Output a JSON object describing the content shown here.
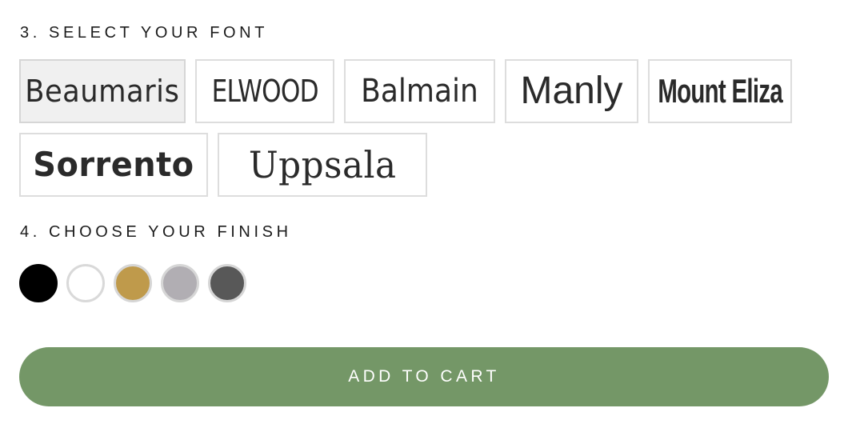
{
  "font_section": {
    "heading": "3. SELECT YOUR FONT",
    "options": [
      {
        "label": "Beaumaris",
        "selected": true
      },
      {
        "label": "ELWOOD",
        "selected": false
      },
      {
        "label": "Balmain",
        "selected": false
      },
      {
        "label": "Manly",
        "selected": false
      },
      {
        "label": "Mount Eliza",
        "selected": false
      },
      {
        "label": "Sorrento",
        "selected": false
      },
      {
        "label": "Uppsala",
        "selected": false
      }
    ]
  },
  "finish_section": {
    "heading": "4. CHOOSE YOUR FINISH",
    "swatches": [
      {
        "name": "black",
        "color": "#000000"
      },
      {
        "name": "white",
        "color": "#ffffff"
      },
      {
        "name": "gold",
        "color": "#bf9a4b"
      },
      {
        "name": "silver",
        "color": "#b1aeb3"
      },
      {
        "name": "graphite",
        "color": "#585858"
      }
    ]
  },
  "cart": {
    "button_label": "ADD TO CART",
    "button_color": "#749767"
  }
}
